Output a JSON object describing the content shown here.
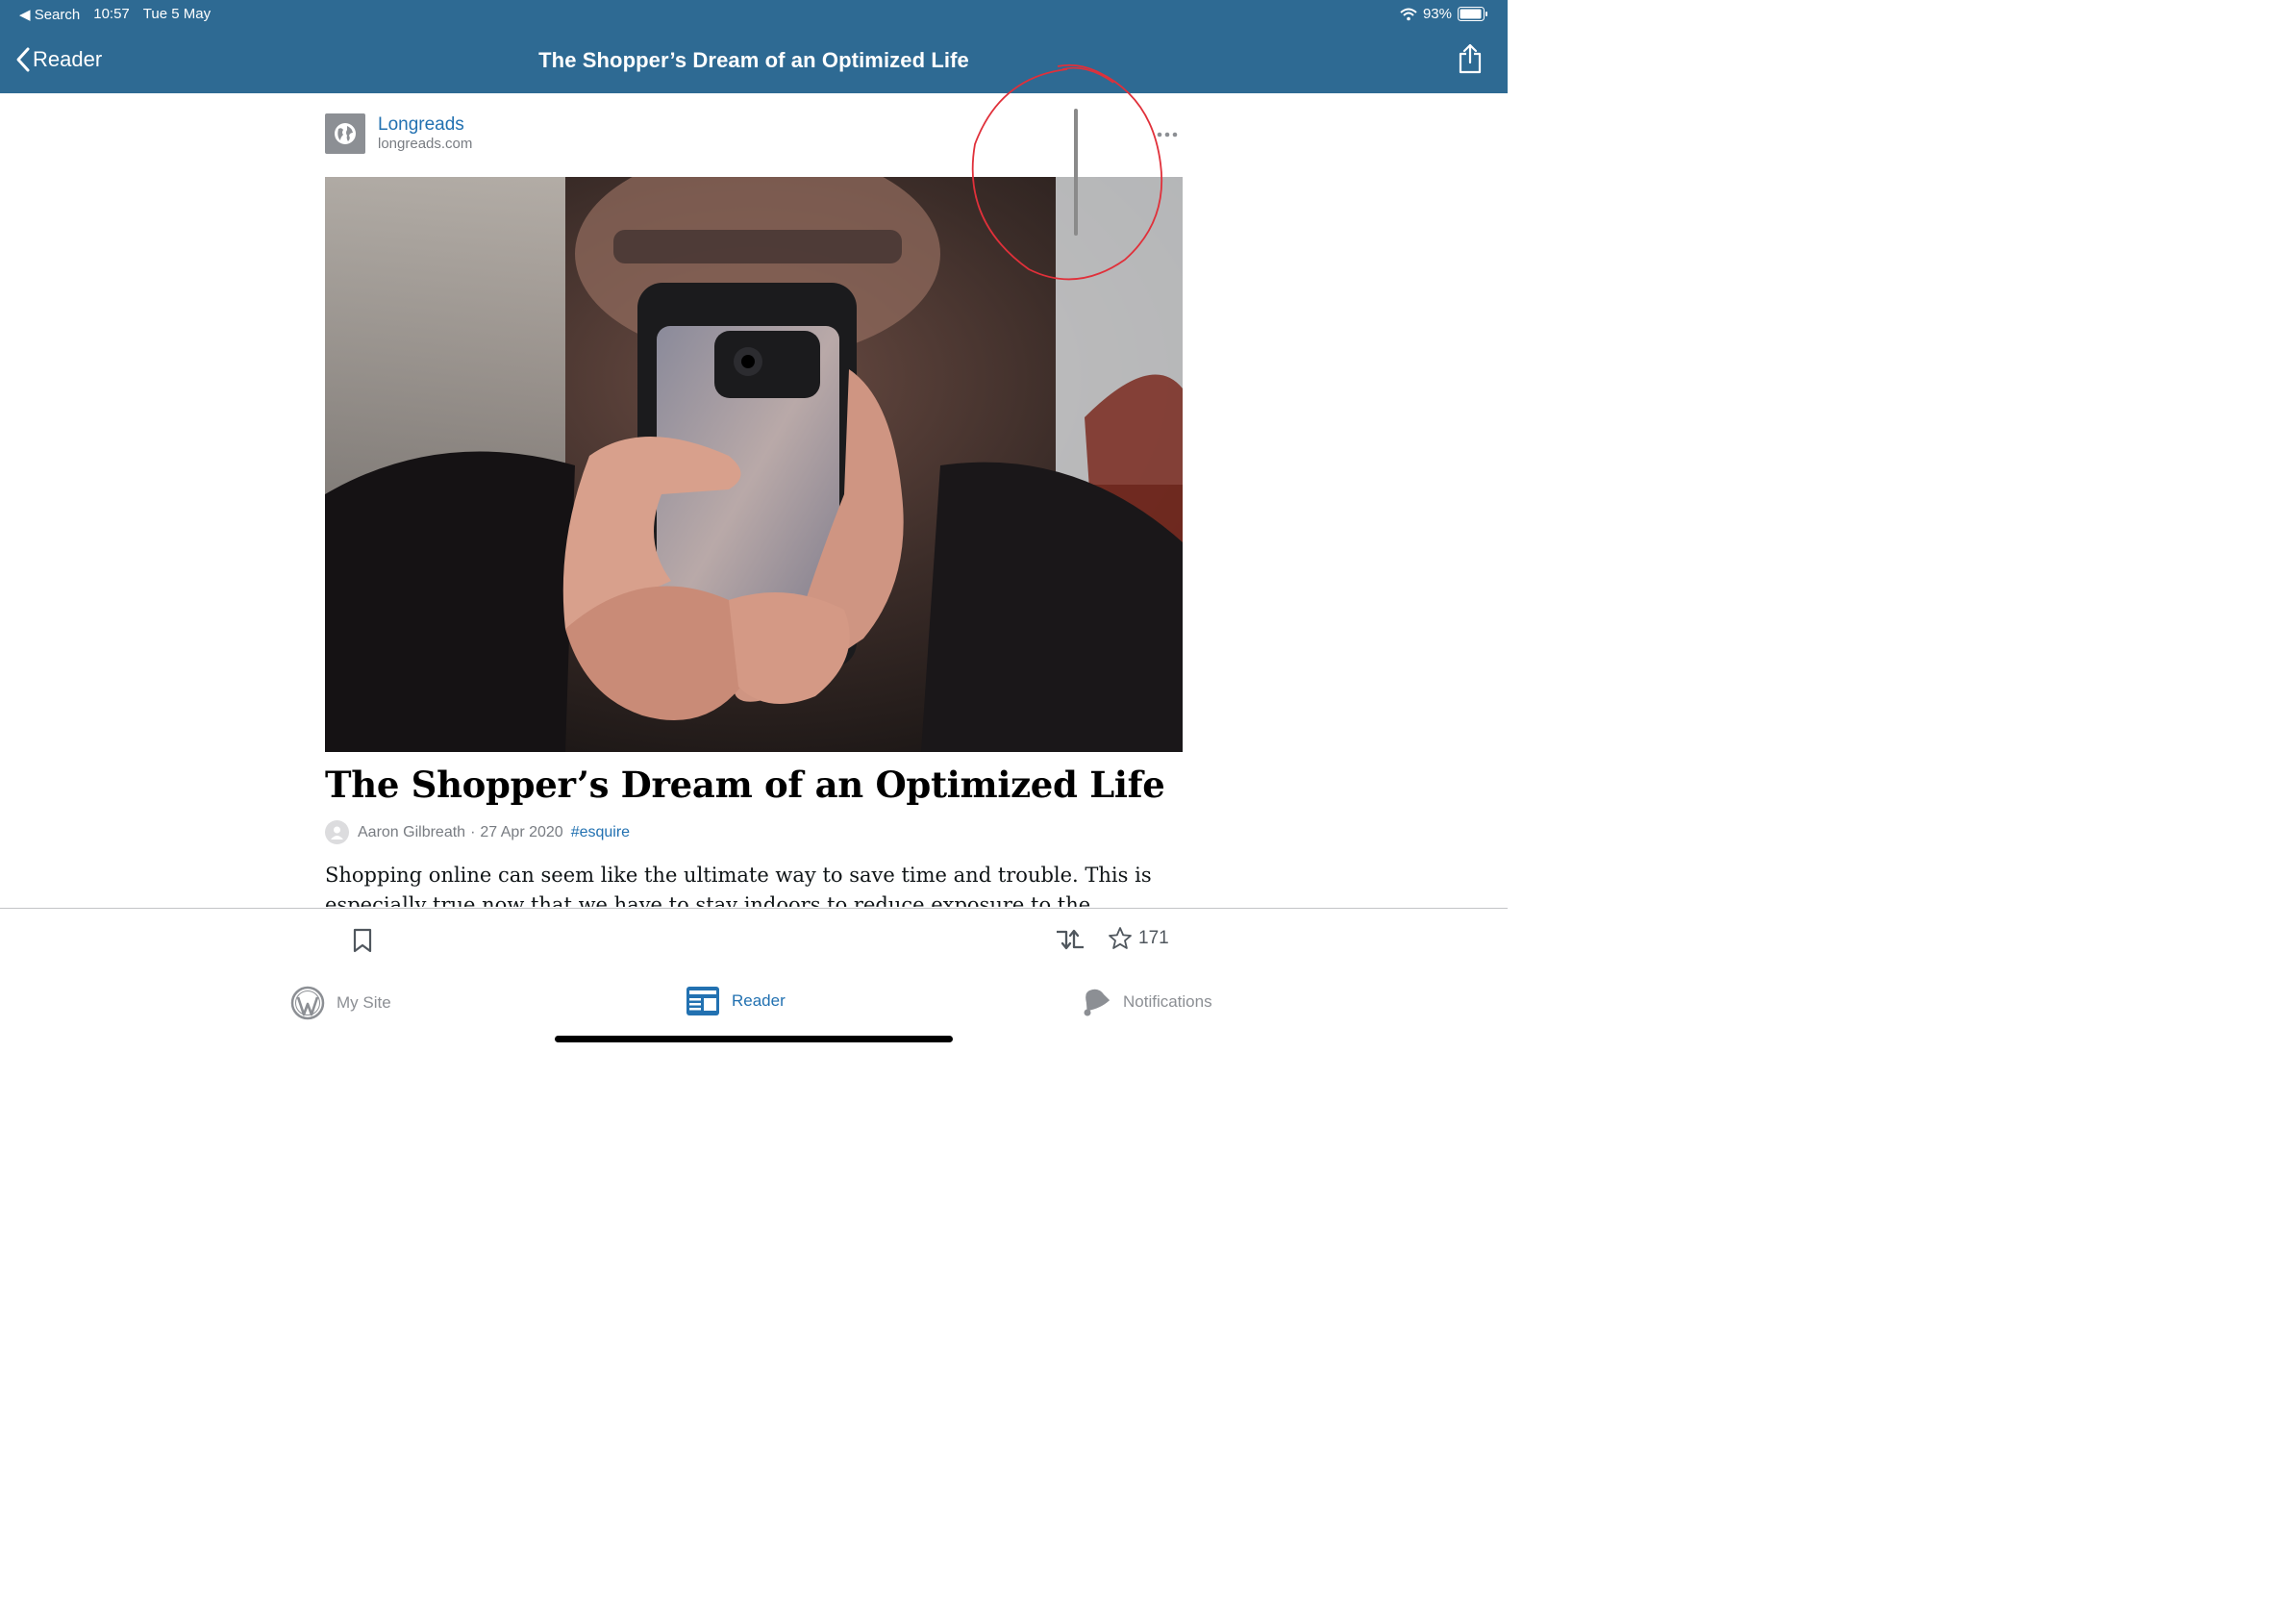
{
  "status_bar": {
    "back_app": "Search",
    "time": "10:57",
    "date": "Tue 5 May",
    "battery": "93%"
  },
  "nav": {
    "back_label": "Reader",
    "title": "The Shopper’s Dream of an Optimized Life"
  },
  "site": {
    "name": "Longreads",
    "url": "longreads.com"
  },
  "post": {
    "title": "The Shopper’s Dream of an Optimized Life",
    "author": "Aaron Gilbreath",
    "date": "27 Apr 2020",
    "separator": "·",
    "tag": "#esquire",
    "excerpt": "Shopping online can seem like the ultimate way to save time and trouble. This is especially true now that we have to stay indoors to reduce exposure to the"
  },
  "actions": {
    "like_count": "171"
  },
  "tabs": [
    {
      "label": "My Site",
      "icon": "wordpress-icon",
      "active": false
    },
    {
      "label": "Reader",
      "icon": "reader-icon",
      "active": true
    },
    {
      "label": "Notifications",
      "icon": "bell-icon",
      "active": false
    }
  ],
  "colors": {
    "header": "#2e6a93",
    "accent": "#2271b1",
    "annotation": "#e0303a"
  }
}
